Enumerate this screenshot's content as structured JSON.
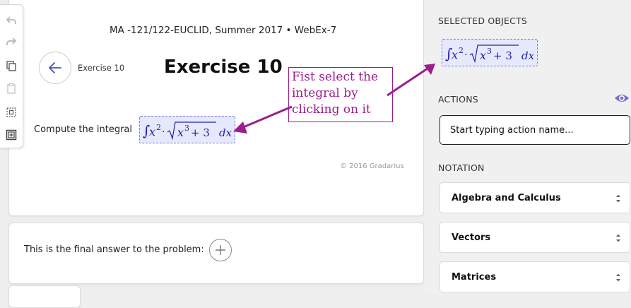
{
  "toolbar": {
    "tools": [
      "undo-icon",
      "redo-icon",
      "copy-icon",
      "paste-icon",
      "select-box-icon",
      "add-box-icon"
    ]
  },
  "header": {
    "course": "MA -121/122-EUCLID, Summer 2017 • WebEx-7",
    "exercise_small": "Exercise 10",
    "exercise_title": "Exercise 10"
  },
  "annotation": {
    "lines": [
      "Fist select the",
      "integral by",
      "clicking on it"
    ],
    "color": "#9b1e8c"
  },
  "problem": {
    "prompt": "Compute the integral",
    "expression": {
      "integral": "∫",
      "base": "x",
      "exp": "2",
      "dot": "·",
      "root_base": "x",
      "root_exp": "3",
      "root_rest": "+ 3",
      "differential": "dx"
    },
    "copyright": "© 2016 Gradarius"
  },
  "answer": {
    "text": "This is the final answer to the problem:"
  },
  "sidebar": {
    "selected_heading": "SELECTED OBJECTS",
    "actions_heading": "ACTIONS",
    "action_placeholder": "Start typing action name...",
    "notation_heading": "NOTATION",
    "notation_options": [
      "Algebra and Calculus",
      "Vectors",
      "Matrices"
    ]
  },
  "colors": {
    "math_text": "#2222aa",
    "math_bg": "#e6e8fb",
    "accent": "#7a6fd0"
  }
}
